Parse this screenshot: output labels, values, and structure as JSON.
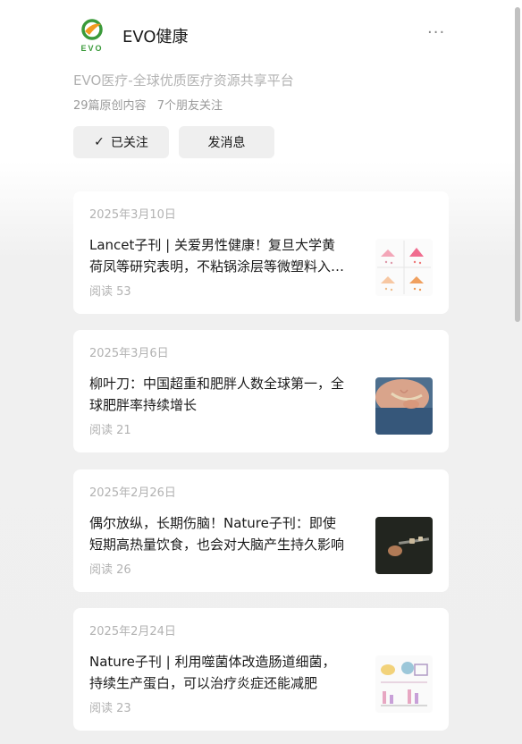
{
  "account": {
    "logo_text": "EVO",
    "name": "EVO健康",
    "more_glyph": "···",
    "description": "EVO医疗-全球优质医疗资源共享平台",
    "original_count": "29篇原创内容",
    "friends_following": "7个朋友关注"
  },
  "actions": {
    "follow_icon": "✓",
    "follow_label": "已关注",
    "message_label": "发消息"
  },
  "articles": [
    {
      "date": "2025年3月10日",
      "title": "Lancet子刊 | 关爱男性健康！复旦大学黄荷凤等研究表明，不粘锅涂层等微塑料入侵男性生殖系统",
      "reads": "阅读 53",
      "thumb_icon": "research-figure-thumbnail"
    },
    {
      "date": "2025年3月6日",
      "title": "柳叶刀：中国超重和肥胖人数全球第一，全球肥胖率持续增长",
      "reads": "阅读 21",
      "thumb_icon": "waist-measuring-thumbnail"
    },
    {
      "date": "2025年2月26日",
      "title": "偶尔放纵，长期伤脑！Nature子刊：即使短期高热量饮食，也会对大脑产生持久影响",
      "reads": "阅读 26",
      "thumb_icon": "food-fork-thumbnail"
    },
    {
      "date": "2025年2月24日",
      "title": "Nature子刊 | 利用噬菌体改造肠道细菌，持续生产蛋白，可以治疗炎症还能减肥",
      "reads": "阅读 23",
      "thumb_icon": "diagram-figure-thumbnail"
    }
  ],
  "colors": {
    "logo_green": "#3a9a3a",
    "logo_orange": "#f29a1f",
    "card_bg": "#ffffff",
    "page_bg": "#efefef"
  }
}
